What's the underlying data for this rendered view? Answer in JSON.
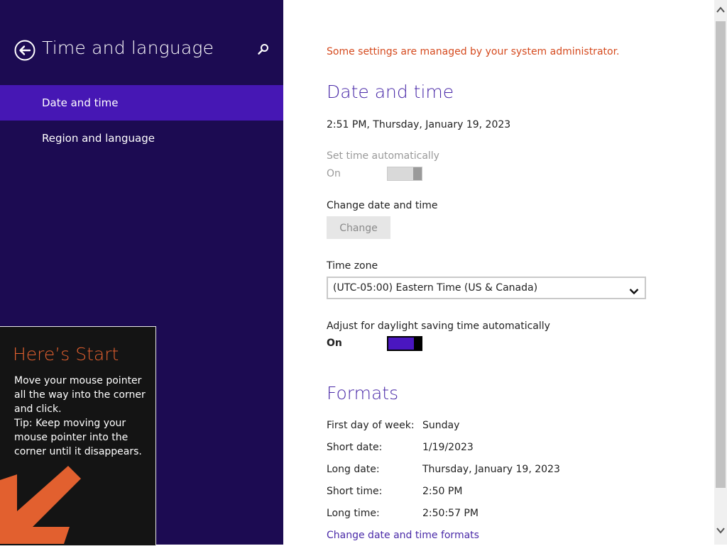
{
  "sidebar": {
    "title": "Time and language",
    "items": [
      {
        "label": "Date and time",
        "selected": true
      },
      {
        "label": "Region and language",
        "selected": false
      }
    ],
    "icons": {
      "back": "back-arrow-circle-icon",
      "search": "search-icon"
    },
    "colors": {
      "background": "#1c0b52",
      "selected": "#4617b4"
    }
  },
  "tip": {
    "title": "Here’s Start",
    "lines": [
      "Move your mouse pointer",
      "all the way into the corner",
      "and click.",
      "Tip: Keep moving your",
      "mouse pointer into the",
      "corner until it disappears."
    ],
    "icon": "corner-arrow-icon"
  },
  "content": {
    "admin_notice": "Some settings are managed by your system administrator.",
    "date_time": {
      "title": "Date and time",
      "current": "2:51 PM, Thursday, January 19, 2023",
      "set_auto_label": "Set time automatically",
      "set_auto_state": "On",
      "change_label": "Change date and time",
      "change_button": "Change",
      "timezone_label": "Time zone",
      "timezone_value": "(UTC-05:00) Eastern Time (US & Canada)",
      "dst_label": "Adjust for daylight saving time automatically",
      "dst_state": "On"
    },
    "formats": {
      "title": "Formats",
      "rows": [
        {
          "key": "First day of week:",
          "value": "Sunday"
        },
        {
          "key": "Short date:",
          "value": "1/19/2023"
        },
        {
          "key": "Long date:",
          "value": "Thursday, January 19, 2023"
        },
        {
          "key": "Short time:",
          "value": "2:50 PM"
        },
        {
          "key": "Long time:",
          "value": "2:50:57 PM"
        }
      ],
      "link": "Change date and time formats"
    },
    "colors": {
      "accent": "#4a2aa8",
      "warning": "#d54a1e",
      "toggle_on": "#4a16c0"
    }
  }
}
